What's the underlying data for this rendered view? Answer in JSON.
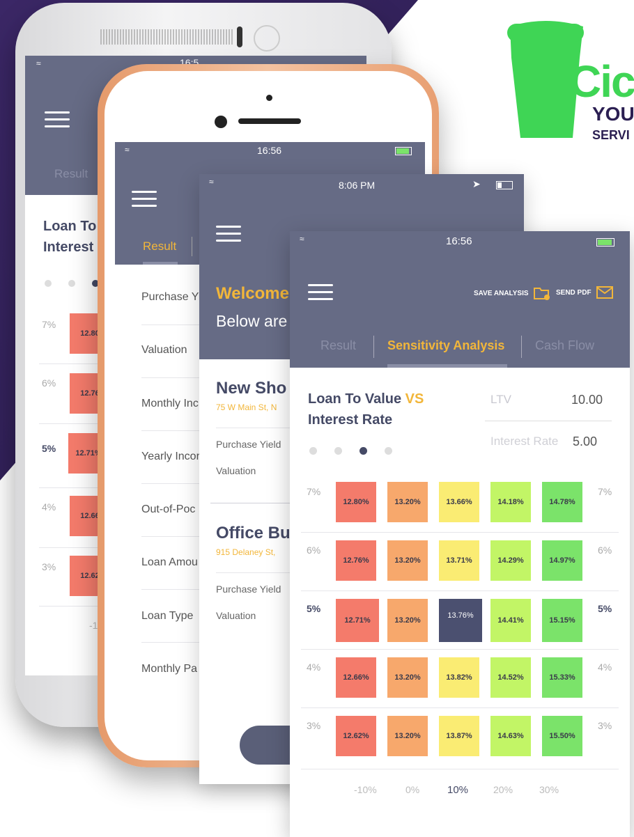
{
  "brand": {
    "logo_text": "Cic",
    "tag1": "YOU",
    "tag2": "SERVI"
  },
  "phone1": {
    "time": "16:5",
    "tab": "Result",
    "title_line1": "Loan To",
    "title_line2": "Interest",
    "ylabels": [
      "7%",
      "6%",
      "5%",
      "4%",
      "3%"
    ],
    "cells": [
      "12.80",
      "12.76",
      "12.71%",
      "12.66",
      "12.62"
    ],
    "xpartial": "-1"
  },
  "phone2": {
    "time": "16:56",
    "tab": "Result",
    "rows": [
      "Purchase Yi",
      "Valuation",
      "Monthly Inc",
      "Yearly Incor",
      "Out-of-Poc",
      "Loan Amou",
      "Loan Type",
      "Monthly Pa"
    ]
  },
  "phone3": {
    "time": "8:06 PM",
    "welcome": "Welcome",
    "below": "Below are",
    "props": [
      {
        "name": "New Sho",
        "addr": "75 W Main St, N",
        "yield_label": "Purchase Yield",
        "val_label": "Valuation"
      },
      {
        "name": "Office Bu",
        "addr": "915 Delaney St,",
        "yield_label": "Purchase Yield",
        "val_label": "Valuation"
      }
    ]
  },
  "phone4": {
    "time": "16:56",
    "save_label": "SAVE ANALYSIS",
    "send_label": "SEND PDF",
    "tabs": [
      "Result",
      "Sensitivity Analysis",
      "Cash Flow"
    ],
    "title_part1": "Loan To Value",
    "title_vs": "VS",
    "title_line2": "Interest Rate",
    "ltv_label": "LTV",
    "ltv_value": "10.00",
    "ir_label": "Interest Rate",
    "ir_value": "5.00",
    "rows": [
      {
        "rate": "7%",
        "cells": [
          "12.80%",
          "13.20%",
          "13.66%",
          "14.18%",
          "14.78%"
        ]
      },
      {
        "rate": "6%",
        "cells": [
          "12.76%",
          "13.20%",
          "13.71%",
          "14.29%",
          "14.97%"
        ]
      },
      {
        "rate": "5%",
        "cells": [
          "12.71%",
          "13.20%",
          "13.76%",
          "14.41%",
          "15.15%"
        ]
      },
      {
        "rate": "4%",
        "cells": [
          "12.66%",
          "13.20%",
          "13.82%",
          "14.52%",
          "15.33%"
        ]
      },
      {
        "rate": "3%",
        "cells": [
          "12.62%",
          "13.20%",
          "13.87%",
          "14.63%",
          "15.50%"
        ]
      }
    ],
    "xlabels": [
      "-10%",
      "0%",
      "10%",
      "20%",
      "30%"
    ],
    "colors": {
      "accent": "#f2b63a",
      "header": "#666b85",
      "col1": "#f47b6b",
      "col2": "#f7a86c",
      "col3": "#faec73",
      "col4": "#c2f566",
      "col5": "#7be36a",
      "selected": "#4b5070"
    }
  }
}
